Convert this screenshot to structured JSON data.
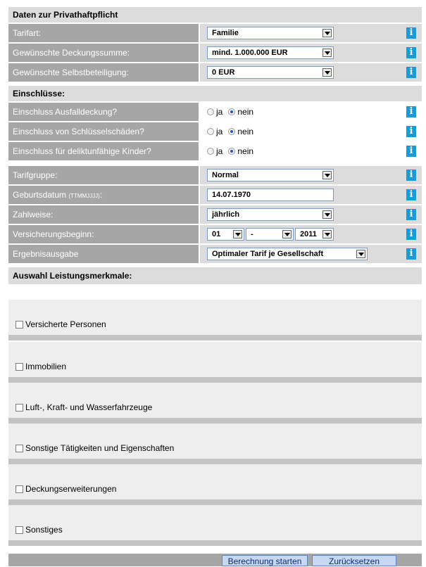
{
  "section1": {
    "title": "Daten zur Privathaftpflicht"
  },
  "rows": {
    "tarifart": {
      "label": "Tarifart:",
      "value": "Familie"
    },
    "deckung": {
      "label": "Gewünschte Deckungssumme:",
      "value": "mind. 1.000.000 EUR"
    },
    "selbst": {
      "label": "Gewünschte Selbstbeteiligung:",
      "value": "0 EUR"
    }
  },
  "section2": {
    "title": "Einschlüsse:"
  },
  "radios": {
    "ja": "ja",
    "nein": "nein",
    "ausfall": {
      "label": "Einschluss Ausfalldeckung?"
    },
    "schluessel": {
      "label": "Einschluss von Schlüsselschäden?"
    },
    "kinder": {
      "label": "Einschluss für deliktunfähige Kinder?"
    }
  },
  "more": {
    "tarifgruppe": {
      "label": "Tarifgruppe:",
      "value": "Normal"
    },
    "geburt": {
      "label": "Geburtsdatum",
      "hint": "(TTMMJJJJ)",
      "suffix": ":",
      "value": "14.07.1970"
    },
    "zahlweise": {
      "label": "Zahlweise:",
      "value": "jährlich"
    },
    "beginn": {
      "label": "Versicherungsbeginn:",
      "day": "01",
      "month": "-",
      "year": "2011"
    },
    "ergebnis": {
      "label": "Ergebnisausgabe",
      "value": "Optimaler Tarif je Gesellschaft"
    }
  },
  "section3": {
    "title": "Auswahl Leistungsmerkmale:"
  },
  "features": [
    "Versicherte Personen",
    "Immobilien",
    "Luft-, Kraft- und Wasserfahrzeuge",
    "Sonstige Tätigkeiten und Eigenschaften",
    "Deckungserweiterungen",
    "Sonstiges"
  ],
  "buttons": {
    "start": "Berechnung starten",
    "reset": "Zurücksetzen"
  },
  "info_icon_glyph": "i",
  "colors": {
    "label_bg": "#a6a6a6",
    "section_bg": "#dcdcdc",
    "info_blue": "#1b9ad8"
  }
}
